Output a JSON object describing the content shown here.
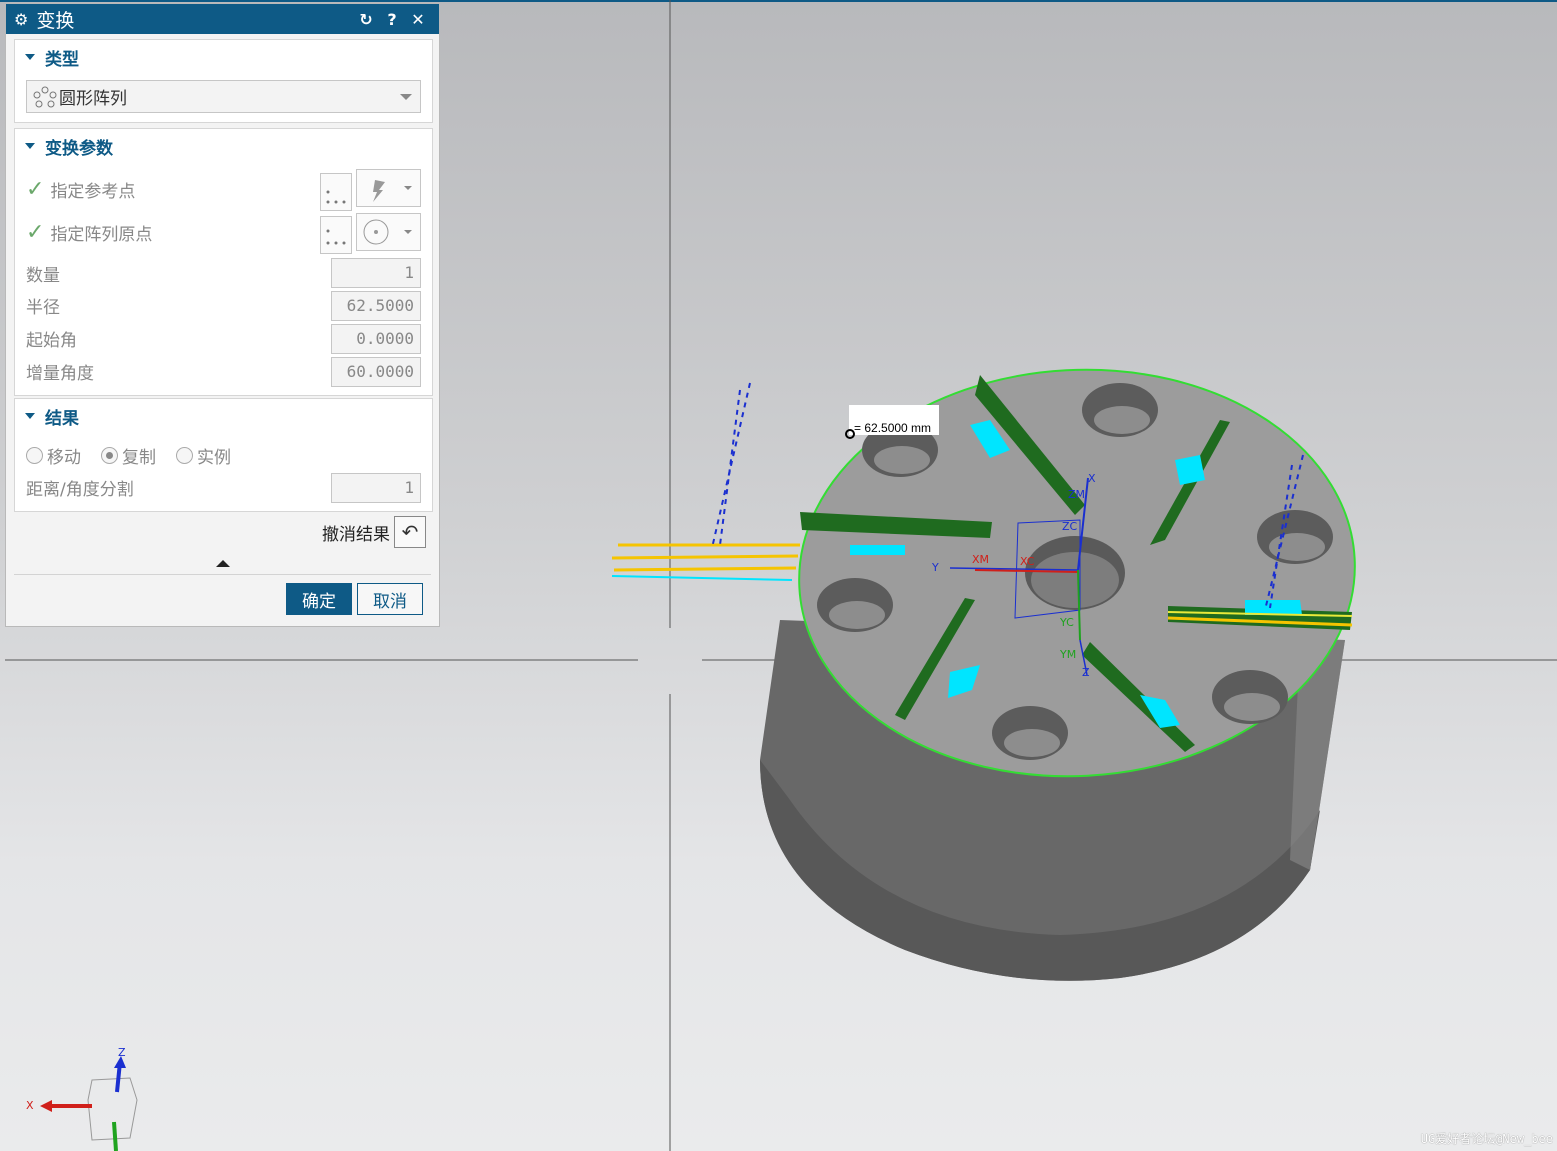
{
  "dialog": {
    "title": "变换",
    "title_icons": [
      "gear-icon",
      "reset-icon",
      "help-icon",
      "close-icon"
    ],
    "help_label": "?",
    "close_label": "✕",
    "reset_label": "↻",
    "gear_label": "⚙"
  },
  "type_group": {
    "header": "类型",
    "selected": "圆形阵列"
  },
  "params_group": {
    "header": "变换参数",
    "ref_point_label": "指定参考点",
    "origin_label": "指定阵列原点",
    "count_label": "数量",
    "count_value": "1",
    "radius_label": "半径",
    "radius_value": "62.5000",
    "start_angle_label": "起始角",
    "start_angle_value": "0.0000",
    "increment_label": "增量角度",
    "increment_value": "60.0000"
  },
  "result_group": {
    "header": "结果",
    "options": [
      "移动",
      "复制",
      "实例"
    ],
    "selected": "复制",
    "distance_label": "距离/角度分割",
    "distance_value": "1"
  },
  "undo_label": "撤消结果",
  "ok_label": "确定",
  "cancel_label": "取消",
  "viewport": {
    "dimension_label": "= 62.5000 mm",
    "csys_labels": {
      "x": "X",
      "y": "Y",
      "z": "Z",
      "xm": "XM",
      "xc": "XC",
      "zm": "ZM",
      "zc": "ZC",
      "yc": "YC",
      "ym": "YM"
    },
    "triad_labels": {
      "x": "X",
      "z": "Z"
    },
    "watermark": "UG爱好者论坛@New_bee"
  },
  "colors": {
    "accent": "#0e5a86",
    "selection_green": "#33dd33",
    "highlight_cyan": "#00e5ff",
    "slot_green": "#1f6b1f",
    "axis_blue": "#1a2fd0",
    "axis_red": "#d0201a",
    "preview_yellow": "#f5c400"
  }
}
